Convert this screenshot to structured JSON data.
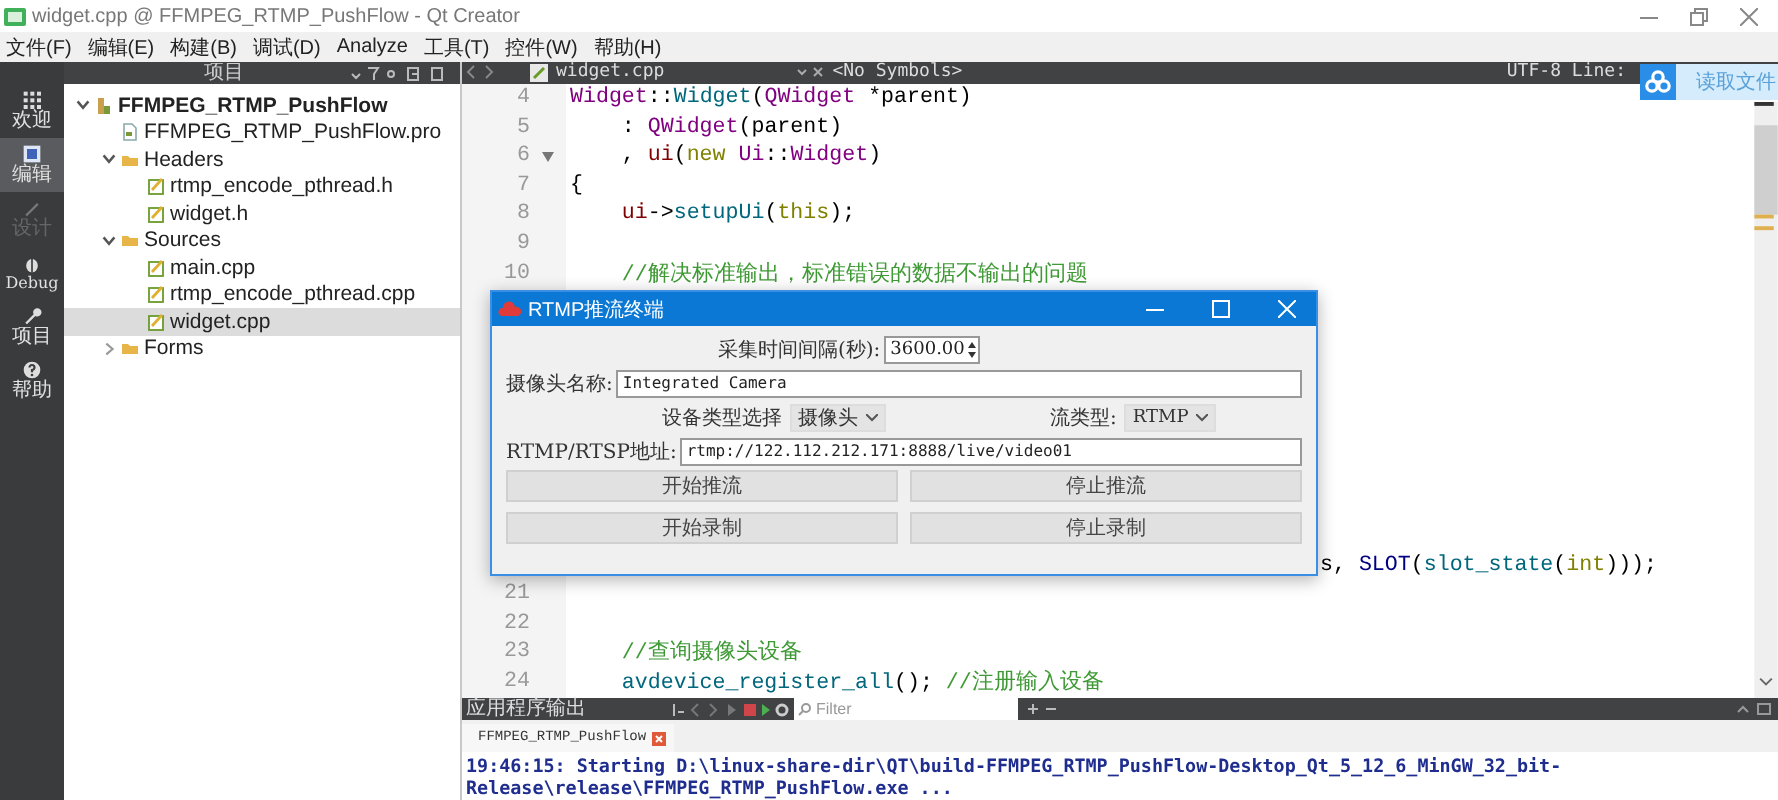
{
  "window": {
    "title": "widget.cpp @ FFMPEG_RTMP_PushFlow - Qt Creator"
  },
  "menu": [
    "文件(F)",
    "编辑(E)",
    "构建(B)",
    "调试(D)",
    "Analyze",
    "工具(T)",
    "控件(W)",
    "帮助(H)"
  ],
  "modes": [
    {
      "label": "欢迎",
      "kind": "welcome",
      "selected": false,
      "disabled": false
    },
    {
      "label": "编辑",
      "kind": "edit",
      "selected": true,
      "disabled": false
    },
    {
      "label": "设计",
      "kind": "design",
      "selected": false,
      "disabled": true
    },
    {
      "label": "Debug",
      "kind": "debug",
      "selected": false,
      "disabled": false
    },
    {
      "label": "项目",
      "kind": "projects",
      "selected": false,
      "disabled": false
    },
    {
      "label": "帮助",
      "kind": "help",
      "selected": false,
      "disabled": false
    }
  ],
  "project_pane": {
    "title": "项目",
    "tree": [
      {
        "label": "FFMPEG_RTMP_PushFlow",
        "kind": "project",
        "expanded": true,
        "selected": false,
        "children": [
          {
            "label": "FFMPEG_RTMP_PushFlow.pro",
            "kind": "pro",
            "selected": false
          },
          {
            "label": "Headers",
            "kind": "folder",
            "expanded": true,
            "selected": false,
            "children": [
              {
                "label": "rtmp_encode_pthread.h",
                "kind": "file",
                "selected": false
              },
              {
                "label": "widget.h",
                "kind": "file",
                "selected": false
              }
            ]
          },
          {
            "label": "Sources",
            "kind": "folder",
            "expanded": true,
            "selected": false,
            "children": [
              {
                "label": "main.cpp",
                "kind": "file",
                "selected": false
              },
              {
                "label": "rtmp_encode_pthread.cpp",
                "kind": "file",
                "selected": false
              },
              {
                "label": "widget.cpp",
                "kind": "file",
                "selected": true
              }
            ]
          },
          {
            "label": "Forms",
            "kind": "folder",
            "expanded": false,
            "selected": false
          }
        ]
      }
    ]
  },
  "editor": {
    "file": "widget.cpp",
    "symbols": "<No Symbols>",
    "encoding": "UTF-8 Line:",
    "lines": [
      {
        "number": "4",
        "fold": false,
        "kind": "full",
        "indented": false,
        "tokens": [
          {
            "t": "Widget",
            "kind": "type"
          },
          {
            "t": "::",
            "kind": "plain"
          },
          {
            "t": "Widget",
            "kind": "func"
          },
          {
            "t": "(",
            "kind": "plain"
          },
          {
            "t": "QWidget",
            "kind": "type"
          },
          {
            "t": " *parent)",
            "kind": "plain"
          }
        ]
      },
      {
        "number": "5",
        "fold": false,
        "kind": "full",
        "indented": true,
        "tokens": [
          {
            "t": ": ",
            "kind": "plain"
          },
          {
            "t": "QWidget",
            "kind": "type"
          },
          {
            "t": "(parent)",
            "kind": "plain"
          }
        ]
      },
      {
        "number": "6",
        "fold": true,
        "kind": "full",
        "indented": true,
        "tokens": [
          {
            "t": ", ",
            "kind": "plain"
          },
          {
            "t": "ui",
            "kind": "member"
          },
          {
            "t": "(",
            "kind": "plain"
          },
          {
            "t": "new",
            "kind": "kw"
          },
          {
            "t": " Ui",
            "kind": "type"
          },
          {
            "t": "::",
            "kind": "plain"
          },
          {
            "t": "Widget",
            "kind": "type"
          },
          {
            "t": ")",
            "kind": "plain"
          }
        ]
      },
      {
        "number": "7",
        "fold": false,
        "kind": "full",
        "indented": false,
        "tokens": [
          {
            "t": "{",
            "kind": "plain"
          }
        ]
      },
      {
        "number": "8",
        "fold": false,
        "kind": "full",
        "indented": true,
        "tokens": [
          {
            "t": "ui",
            "kind": "member"
          },
          {
            "t": "->",
            "kind": "plain"
          },
          {
            "t": "setupUi",
            "kind": "func"
          },
          {
            "t": "(",
            "kind": "plain"
          },
          {
            "t": "this",
            "kind": "kw"
          },
          {
            "t": ");",
            "kind": "plain"
          }
        ]
      },
      {
        "number": "9",
        "fold": false,
        "kind": "full"
      },
      {
        "number": "10",
        "fold": false,
        "kind": "full",
        "indented": true,
        "tokens": [
          {
            "t": "//解决标准输出，标准错误的数据不输出的问题",
            "kind": "comment"
          }
        ]
      },
      {
        "kind": "partial",
        "tokens": [
          {
            "t": "s, ",
            "kind": "plain"
          },
          {
            "t": "SLOT",
            "kind": "macro"
          },
          {
            "t": "(",
            "kind": "plain"
          },
          {
            "t": "slot_state",
            "kind": "func"
          },
          {
            "t": "(",
            "kind": "plain"
          },
          {
            "t": "int",
            "kind": "kw"
          },
          {
            "t": ")));",
            "kind": "plain"
          }
        ]
      },
      {
        "number": "21",
        "fold": false,
        "kind": "full"
      },
      {
        "number": "22",
        "fold": false,
        "kind": "full"
      },
      {
        "number": "23",
        "fold": false,
        "kind": "full",
        "indented": true,
        "tokens": [
          {
            "t": "//查询摄像头设备",
            "kind": "comment"
          }
        ]
      },
      {
        "number": "24",
        "fold": false,
        "kind": "full",
        "indented": true,
        "tokens": [
          {
            "t": "avdevice_register_all",
            "kind": "func"
          },
          {
            "t": "(); ",
            "kind": "plain"
          },
          {
            "t": "//注册输入设备",
            "kind": "comment"
          }
        ]
      }
    ]
  },
  "overlay_badge": {
    "label": "读取文件"
  },
  "dialog": {
    "title": "RTMP推流终端",
    "interval_label": "采集时间间隔(秒):",
    "interval_value": "3600.00",
    "camera_label": "摄像头名称:",
    "camera_value": "Integrated Camera",
    "device_type_label": "设备类型选择",
    "device_type_value": "摄像头",
    "stream_type_label": "流类型:",
    "stream_type_value": "RTMP",
    "url_label": "RTMP/RTSP地址:",
    "url_value": "rtmp://122.112.212.171:8888/live/video01",
    "buttons": [
      "开始推流",
      "停止推流",
      "开始录制",
      "停止录制"
    ]
  },
  "output": {
    "title": "应用程序输出",
    "filter_placeholder": "Filter",
    "tab": "FFMPEG_RTMP_PushFlow",
    "lines": [
      "19:46:15: Starting D:\\linux-share-dir\\QT\\build-FFMPEG_RTMP_PushFlow-Desktop_Qt_5_12_6_MinGW_32_bit-",
      "Release\\release\\FFMPEG_RTMP_PushFlow.exe ..."
    ]
  }
}
